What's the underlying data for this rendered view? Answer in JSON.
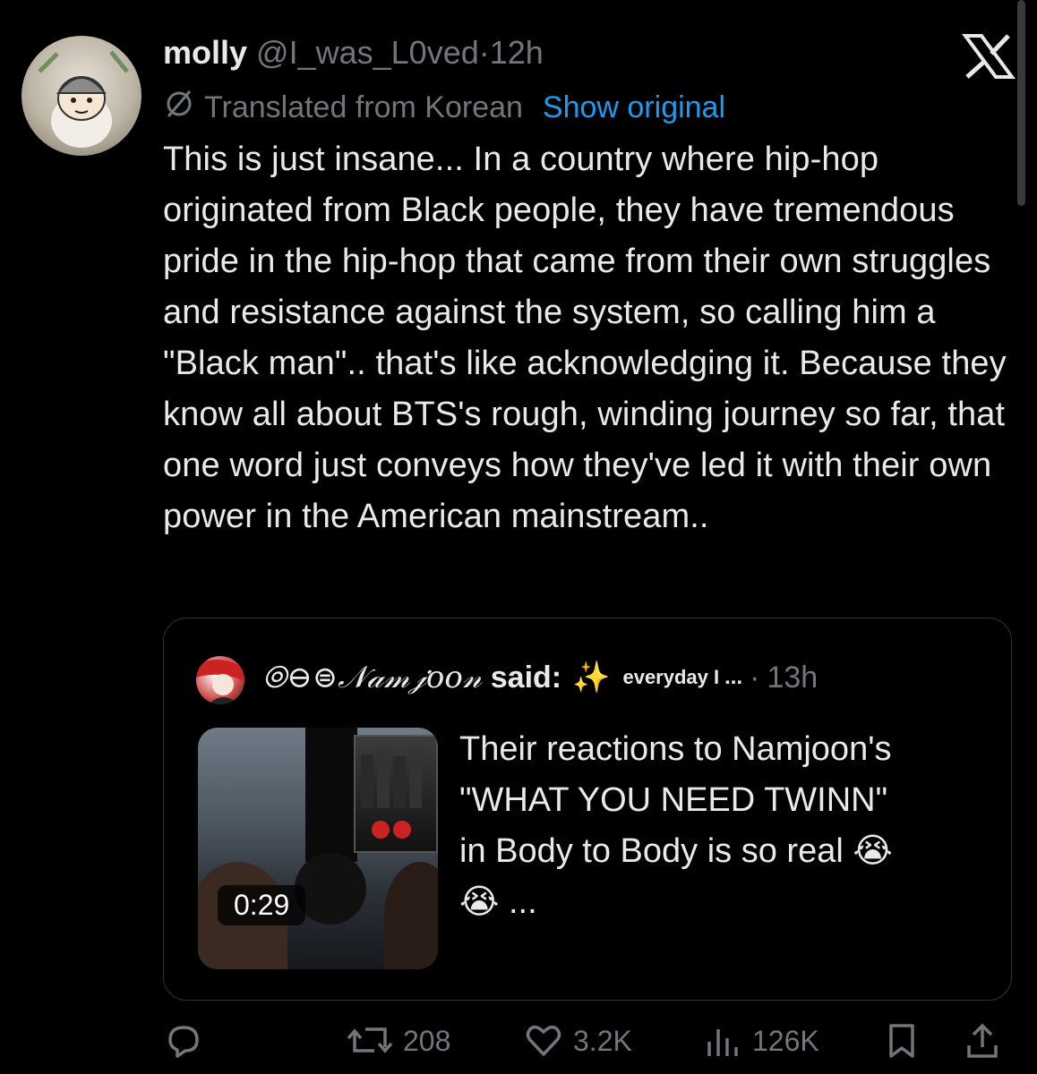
{
  "tweet": {
    "display_name": "molly",
    "handle": "@I_was_L0ved",
    "separator": "·",
    "time": "12h",
    "translated_label": "Translated from Korean",
    "show_original": "Show original",
    "body": "This is just insane... In a country where hip-hop originated from Black people, they have tremendous pride in the hip-hop that came from their own struggles and resistance against the system, so calling him a \"Black man\".. that's like acknowledging it. Because they know all about BTS's rough, winding journey so far, that one word just conveys how they've led it with their own power in the American mainstream.."
  },
  "quote": {
    "display_name": "⦾⊖⊜𝒩𝒶𝓂𝒿𝑜𝑜𝓃",
    "said": "said:",
    "sparkle": "✨",
    "handle": "everyday I",
    "ellipsis": "...",
    "separator": "·",
    "time": "13h",
    "video_duration": "0:29",
    "text_line1": "Their reactions to Namjoon's",
    "text_line2": "\"WHAT YOU NEED TWINN\"",
    "text_line3": "in Body to Body is so real 😭",
    "text_line4": "😭 ..."
  },
  "actions": {
    "reposts": "208",
    "likes": "3.2K",
    "views": "126K"
  },
  "icons": {
    "reply": "reply-icon",
    "repost": "repost-icon",
    "like": "heart-icon",
    "views": "views-icon",
    "bookmark": "bookmark-icon",
    "share": "share-icon",
    "close": "x-logo-icon"
  },
  "colors": {
    "background": "#000000",
    "text": "#e7e9ea",
    "muted": "#71767b",
    "link": "#1d9bf0",
    "border": "#2f3336"
  }
}
